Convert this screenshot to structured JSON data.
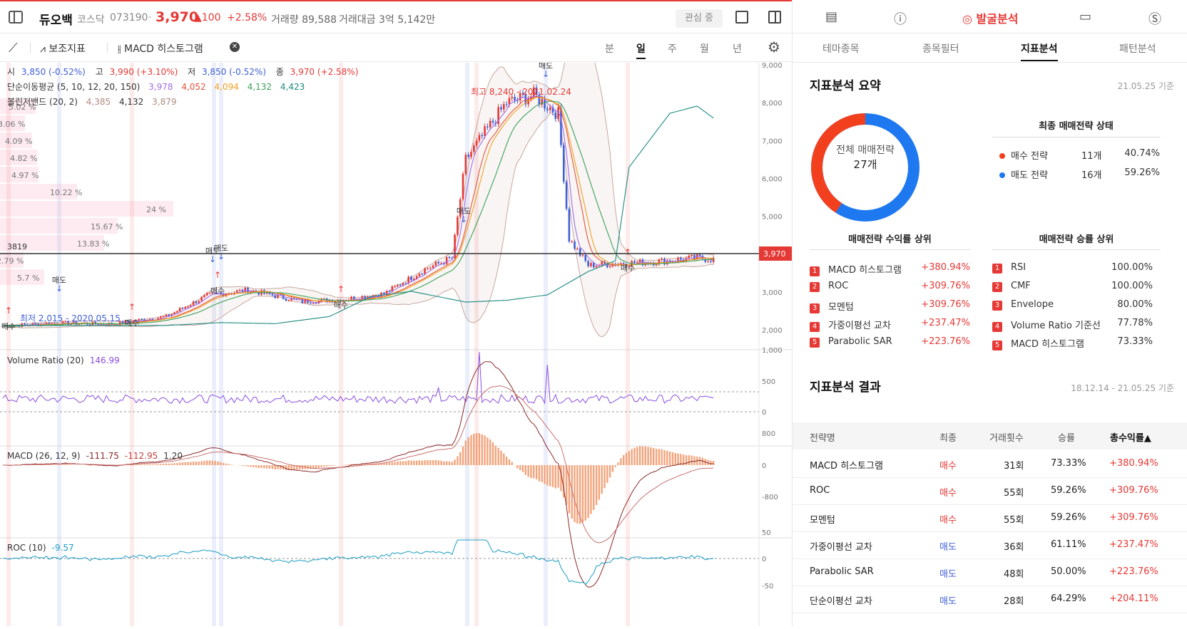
{
  "header": {
    "stock_name": "듀오백",
    "market": "코스닥",
    "code": "073190",
    "price": "3,970",
    "change": "▲100",
    "change_pct": "+2.58%",
    "volume_label": "거래량 89,588",
    "amount_label": "거래대금 3억 5,142만",
    "fav_label": "관심 중"
  },
  "toolbar": {
    "indicator_label": "보조지표",
    "macd_label": "MACD 히스토그램",
    "periods": [
      "분",
      "일",
      "주",
      "월",
      "년"
    ],
    "active_period": "일"
  },
  "chart": {
    "ohlc_line": {
      "open_label": "시",
      "open": "3,850 (-0.52%)",
      "high_label": "고",
      "high": "3,990 (+3.10%)",
      "low_label": "저",
      "low": "3,850 (-0.52%)",
      "close_label": "종",
      "close": "3,970 (+2.58%)"
    },
    "ma_label": "단순이동평균 (5, 10, 12, 20, 150)",
    "ma_values": [
      "3,978",
      "4,052",
      "4,094",
      "4,132",
      "4,423"
    ],
    "ma_colors": [
      "#a16ee8",
      "#e5533b",
      "#f0a020",
      "#3ea05a",
      "#1c8a82"
    ],
    "bb_label": "볼린저밴드 (20, 2)",
    "bb_values": [
      "4,385",
      "4,132",
      "3,879"
    ],
    "price_axis": [
      "9,000",
      "8,000",
      "7,000",
      "6,000",
      "5,000",
      "4,000",
      "3,000",
      "2,000"
    ],
    "current_price_tag": "3,970",
    "left_price_line": "3819",
    "high_note": "최고 8,240 - 2021.02.24",
    "low_note": "최저 2,015 - 2020.05.15",
    "buy_label": "매수",
    "sell_label": "매도",
    "volume_profile": [
      "5.02 %",
      "3.06 %",
      "4.09 %",
      "4.82 %",
      "4.97 %",
      "10.22 %",
      "24 %",
      "15.67 %",
      "13.83 %",
      "2.79 %",
      "5.7 %"
    ],
    "vr_label": "Volume Ratio (20)",
    "vr_value": "146.99",
    "vr_axis": [
      "1,000",
      "500",
      "0"
    ],
    "macd_label": "MACD (26, 12, 9)",
    "macd_values": [
      "-111.75",
      "-112.95",
      "1.20"
    ],
    "macd_axis": [
      "800",
      "0",
      "-800"
    ],
    "roc_label": "ROC (10)",
    "roc_value": "-9.57",
    "roc_axis": [
      "50",
      "0",
      "-50"
    ]
  },
  "right_nav": {
    "active_label": "발굴분석",
    "tabs": [
      "테마종목",
      "종목필터",
      "지표분석",
      "패턴분석"
    ],
    "active_tab": "지표분석"
  },
  "summary": {
    "title": "지표분석 요약",
    "date": "21.05.25 기준",
    "donut_label": "전체 매매전략",
    "donut_count": "27개",
    "buy_ratio": 0.4074,
    "final_title": "최종 매매전략 상태",
    "legend": [
      {
        "label": "매수 전략",
        "count": "11개",
        "pct": "40.74%",
        "color": "#f2401f"
      },
      {
        "label": "매도 전략",
        "count": "16개",
        "pct": "59.26%",
        "color": "#1e78f0"
      }
    ],
    "profit_title": "매매전략 수익률 상위",
    "profit_rank": [
      {
        "n": "1",
        "name": "MACD 히스토그램",
        "val": "+380.94%"
      },
      {
        "n": "2",
        "name": "ROC",
        "val": "+309.76%"
      },
      {
        "n": "3",
        "name": "모멘텀",
        "val": "+309.76%"
      },
      {
        "n": "4",
        "name": "가중이평선 교차",
        "val": "+237.47%"
      },
      {
        "n": "5",
        "name": "Parabolic SAR",
        "val": "+223.76%"
      }
    ],
    "win_title": "매매전략 승률 상위",
    "win_rank": [
      {
        "n": "1",
        "name": "RSI",
        "val": "100.00%"
      },
      {
        "n": "2",
        "name": "CMF",
        "val": "100.00%"
      },
      {
        "n": "3",
        "name": "Envelope",
        "val": "80.00%"
      },
      {
        "n": "4",
        "name": "Volume Ratio 기준선",
        "val": "77.78%"
      },
      {
        "n": "5",
        "name": "MACD 히스토그램",
        "val": "73.33%"
      }
    ]
  },
  "result": {
    "title": "지표분석 결과",
    "date": "18.12.14 - 21.05.25 기준",
    "headers": [
      "전략명",
      "최종",
      "거래횟수",
      "승률",
      "총수익률▲"
    ],
    "rows": [
      {
        "name": "MACD 히스토그램",
        "final": "매수",
        "trades": "31회",
        "win": "73.33%",
        "ret": "+380.94%"
      },
      {
        "name": "ROC",
        "final": "매수",
        "trades": "55회",
        "win": "59.26%",
        "ret": "+309.76%"
      },
      {
        "name": "모멘텀",
        "final": "매수",
        "trades": "55회",
        "win": "59.26%",
        "ret": "+309.76%"
      },
      {
        "name": "가중이평선 교차",
        "final": "매도",
        "trades": "36회",
        "win": "61.11%",
        "ret": "+237.47%"
      },
      {
        "name": "Parabolic SAR",
        "final": "매도",
        "trades": "48회",
        "win": "50.00%",
        "ret": "+223.76%"
      },
      {
        "name": "단순이평선 교차",
        "final": "매도",
        "trades": "28회",
        "win": "64.29%",
        "ret": "+204.11%"
      }
    ]
  }
}
